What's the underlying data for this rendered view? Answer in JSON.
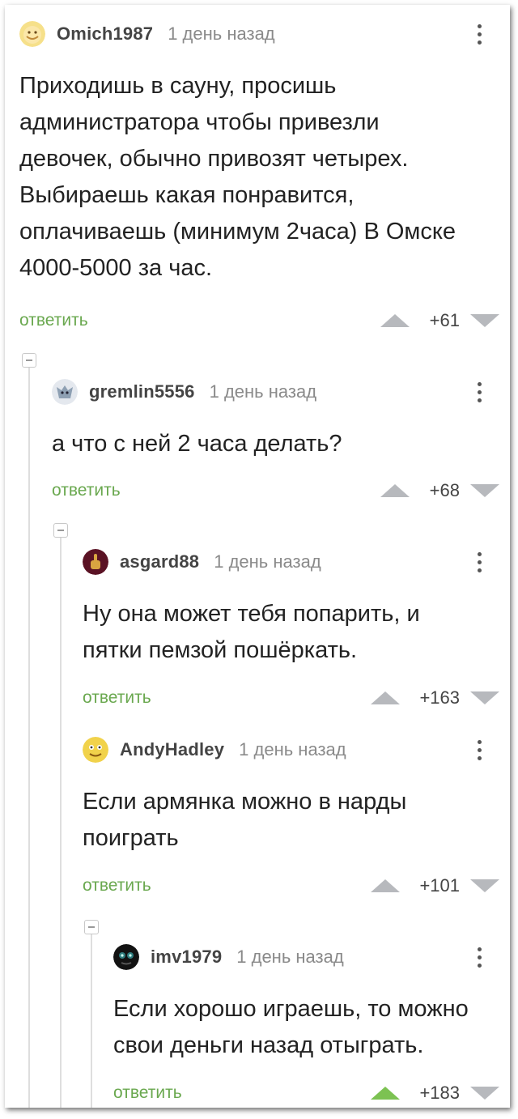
{
  "comments": [
    {
      "user": "Omich1987",
      "time": "1 день назад",
      "text": "Приходишь в сауну, просишь\nадминистратора чтобы привезли\nдевочек, обычно привозят четырех.\nВыбираешь какая понравится,\nоплачиваешь (минимум 2часа) В Омске\n4000-5000 за час.",
      "reply": "ответить",
      "score": "+61",
      "avatar": "smiley-face-avatar"
    },
    {
      "user": "gremlin5556",
      "time": "1 день назад",
      "text": "а что с ней 2 часа делать?",
      "reply": "ответить",
      "score": "+68",
      "avatar": "gremlin-avatar"
    },
    {
      "user": "asgard88",
      "time": "1 день назад",
      "text": "Ну она может тебя попарить, и\nпятки пемзой пошёркать.",
      "reply": "ответить",
      "score": "+163",
      "avatar": "hand-gesture-avatar"
    },
    {
      "user": "AndyHadley",
      "time": "1 день назад",
      "text": "Если армянка можно в нарды\nпоиграть",
      "reply": "ответить",
      "score": "+101",
      "avatar": "yellow-face-avatar"
    },
    {
      "user": "imv1979",
      "time": "1 день назад",
      "text": "Если хорошо играешь, то можно\nсвои деньги назад отыграть.",
      "reply": "ответить",
      "score": "+183",
      "avatar": "dark-creature-avatar",
      "upvoted": true
    }
  ],
  "colors": {
    "reply": "#6aa84f",
    "upvote_active": "#7cc252",
    "vote_arrow": "#b7b9bd"
  }
}
